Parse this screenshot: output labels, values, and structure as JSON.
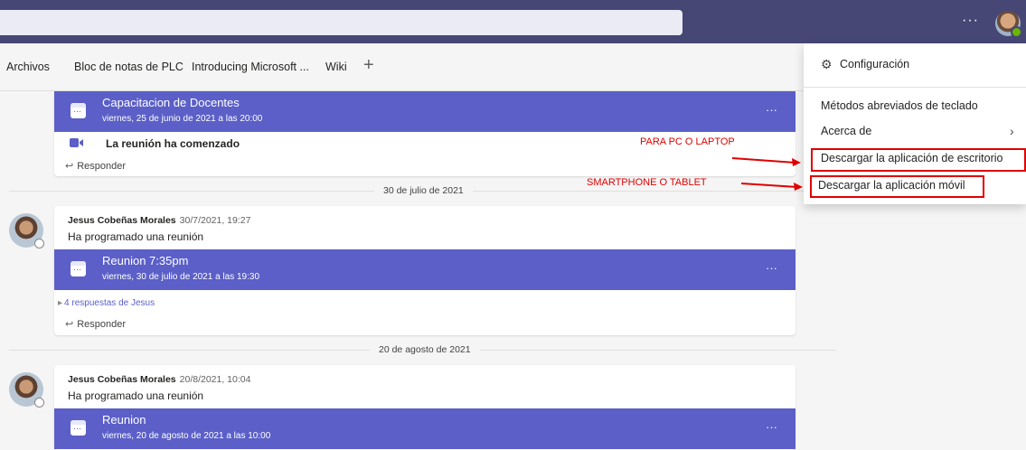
{
  "header": {
    "more_label": "···"
  },
  "tabs": {
    "items": [
      "Archivos",
      "Bloc de notas de PLC",
      "Introducing Microsoft ...",
      "Wiki"
    ],
    "add_label": "+"
  },
  "card1": {
    "meeting_title": "Capacitacion de Docentes",
    "meeting_subtitle": "viernes, 25 de junio de 2021 a las 20:00",
    "started_label": "La reunión ha comenzado",
    "reply_label": "Responder"
  },
  "date1": "30 de julio de 2021",
  "card2": {
    "sender": "Jesus Cobeñas Morales",
    "time": "30/7/2021, 19:27",
    "message": "Ha programado una reunión",
    "meeting_title": "Reunion 7:35pm",
    "meeting_subtitle": "viernes, 30 de julio de 2021 a las 19:30",
    "replies_label": "4 respuestas de Jesus",
    "reply_label": "Responder"
  },
  "date2": "20 de agosto de 2021",
  "card3": {
    "sender": "Jesus Cobeñas Morales",
    "time": "20/8/2021, 10:04",
    "message": "Ha programado una reunión",
    "meeting_title": "Reunion",
    "meeting_subtitle": "viernes, 20 de agosto de 2021 a las 10:00"
  },
  "menu": {
    "settings": "Configuración",
    "shortcuts": "Métodos abreviados de teclado",
    "about": "Acerca de",
    "download_desktop": "Descargar la aplicación de escritorio",
    "download_mobile": "Descargar la aplicación móvil"
  },
  "annotations": {
    "pc_note": "PARA PC O LAPTOP",
    "mobile_note": "SMARTPHONE O TABLET"
  },
  "colors": {
    "header": "#464775",
    "meeting_bar": "#5b5fc7",
    "annotation": "#e00000"
  }
}
